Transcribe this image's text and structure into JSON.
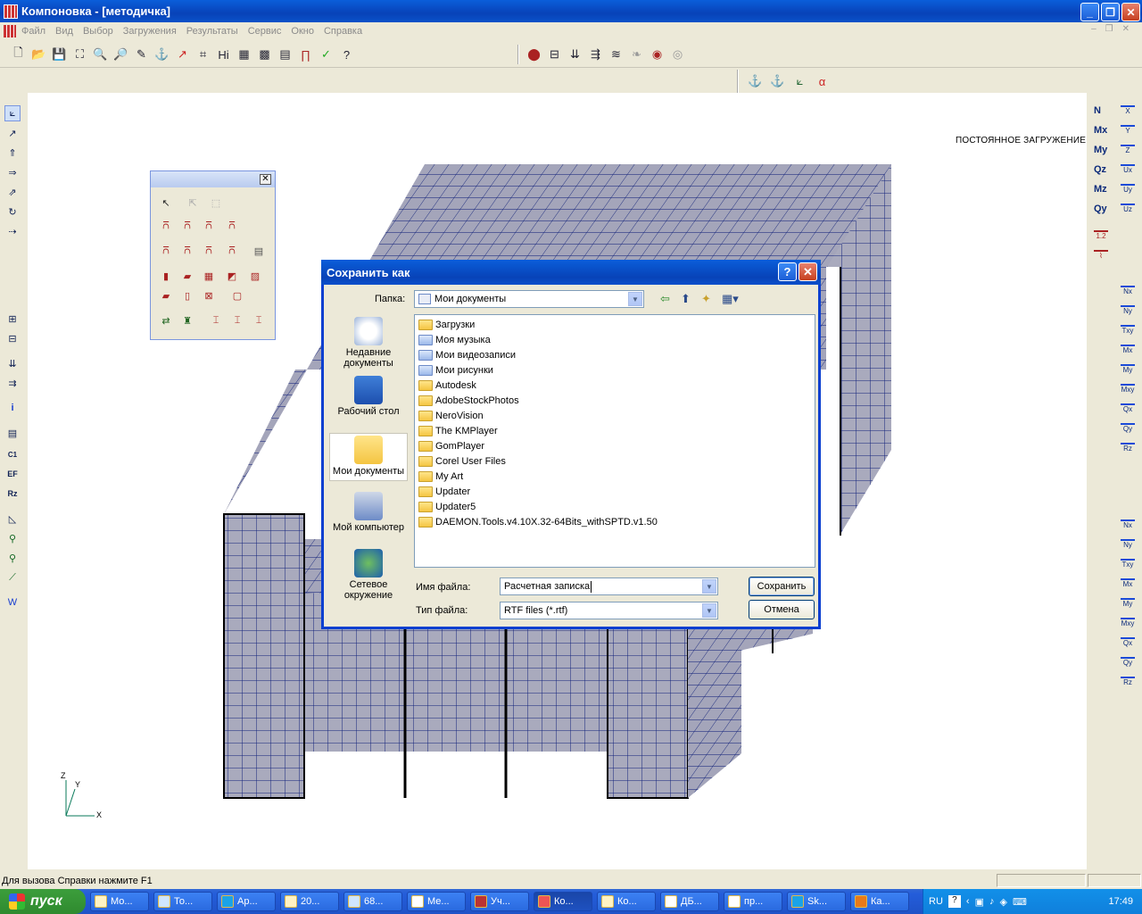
{
  "window": {
    "title": "Компоновка - [методичка]"
  },
  "menu": [
    "Файл",
    "Вид",
    "Выбор",
    "Загружения",
    "Результаты",
    "Сервис",
    "Окно",
    "Справка"
  ],
  "canvas": {
    "load_label": "ПОСТОЯННОЕ ЗАГРУЖЕНИЕ",
    "axes": {
      "z": "Z",
      "y": "Y",
      "x": "X"
    }
  },
  "right_toolbar": {
    "forces": [
      "N",
      "Mx",
      "My",
      "Qz",
      "Mz",
      "Qy"
    ],
    "disp": [
      "X",
      "Y",
      "Z",
      "Ux",
      "Uy",
      "Uz"
    ],
    "extra": [
      "1.2"
    ],
    "stress1": [
      "Nx",
      "Ny",
      "Txy",
      "Mx",
      "My",
      "Mxy",
      "Qx",
      "Qy",
      "Rz"
    ],
    "stress2": [
      "Nx",
      "Ny",
      "Txy",
      "Mx",
      "My",
      "Mxy",
      "Qx",
      "Qy",
      "Rz"
    ]
  },
  "left_toolbar": {
    "info": "i",
    "c1": "C1",
    "ef": "EF",
    "rz": "Rz"
  },
  "toolbar2": {
    "alpha": "α"
  },
  "dialog": {
    "title": "Сохранить как",
    "help": "?",
    "folder_label": "Папка:",
    "folder_value": "Мои документы",
    "places": [
      "Недавние документы",
      "Рабочий стол",
      "Мои документы",
      "Мой компьютер",
      "Сетевое окружение"
    ],
    "files": [
      "Загрузки",
      "Моя музыка",
      "Мои видеозаписи",
      "Мои рисунки",
      "Autodesk",
      "AdobeStockPhotos",
      "NeroVision",
      "The KMPlayer",
      "GomPlayer",
      "Corel User Files",
      "My Art",
      "Updater",
      "Updater5",
      "DAEMON.Tools.v4.10X.32-64Bits_withSPTD.v1.50"
    ],
    "filename_label": "Имя файла:",
    "filename_value": "Расчетная записка",
    "filetype_label": "Тип файла:",
    "filetype_value": "RTF files (*.rtf)",
    "save_button": "Сохранить",
    "cancel_button": "Отмена"
  },
  "status": {
    "text": "Для вызова Справки нажмите F1"
  },
  "taskbar": {
    "start": "пуск",
    "tasks": [
      "Мо...",
      "То...",
      "Ар...",
      "20...",
      "68...",
      "Ме...",
      "Уч...",
      "Ко...",
      "Ко...",
      "ДБ...",
      "пр...",
      "Sk...",
      "Ка..."
    ],
    "lang": "RU",
    "clock": "17:49"
  }
}
